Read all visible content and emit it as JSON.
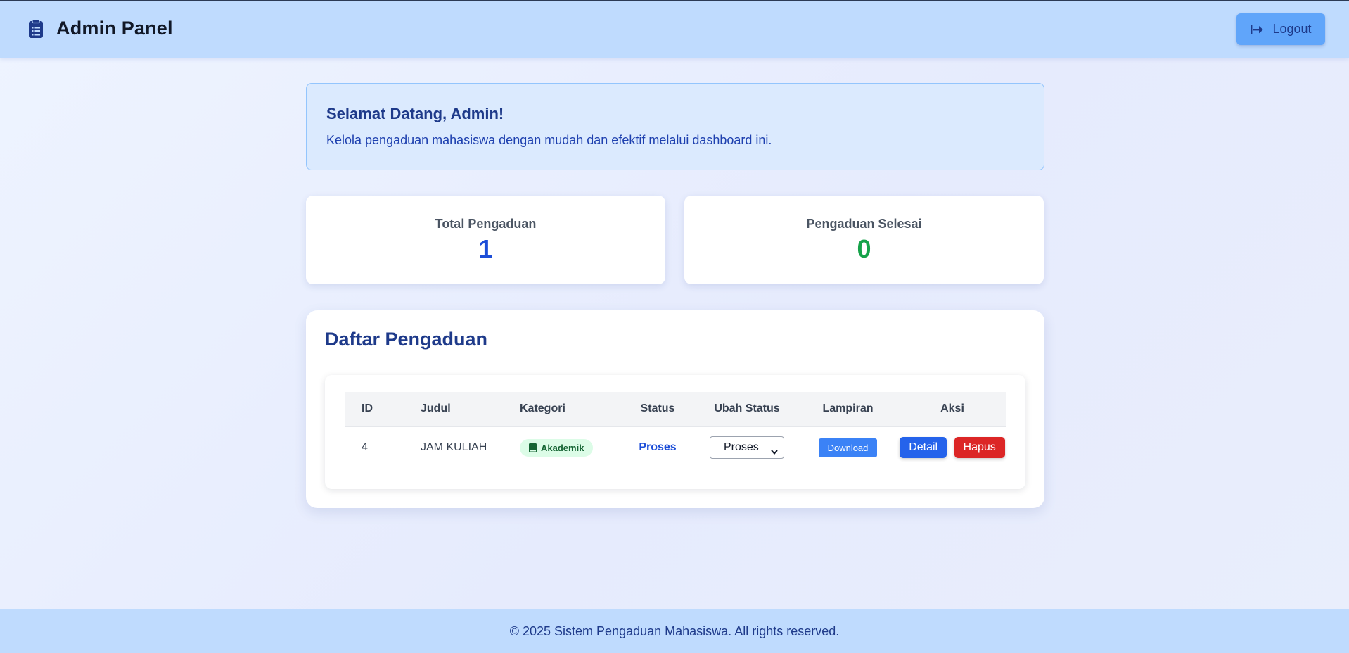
{
  "header": {
    "title": "Admin Panel",
    "brand_icon": "clipboard-list-icon",
    "logout_label": "Logout",
    "logout_icon": "arrow-right-to-bracket-icon"
  },
  "welcome": {
    "title": "Selamat Datang, Admin!",
    "text": "Kelola pengaduan mahasiswa dengan mudah dan efektif melalui dashboard ini."
  },
  "stats": {
    "total_label": "Total Pengaduan",
    "total_value": "1",
    "done_label": "Pengaduan Selesai",
    "done_value": "0"
  },
  "list": {
    "title": "Daftar Pengaduan",
    "columns": [
      "ID",
      "Judul",
      "Kategori",
      "Status",
      "Ubah Status",
      "Lampiran",
      "Aksi"
    ],
    "rows": [
      {
        "id": "4",
        "judul": "JAM KULIAH",
        "kategori": "Akademik",
        "kategori_icon": "book-icon",
        "status": "Proses",
        "ubah_status": "Proses",
        "lampiran_label": "Download",
        "detail_label": "Detail",
        "hapus_label": "Hapus"
      }
    ]
  },
  "footer": {
    "text": "© 2025 Sistem Pengaduan Mahasiswa. All rights reserved."
  },
  "colors": {
    "header_bg": "#bfdbfe",
    "accent_blue": "#1d4ed8",
    "success_green": "#16a34a",
    "danger_red": "#dc2626"
  }
}
